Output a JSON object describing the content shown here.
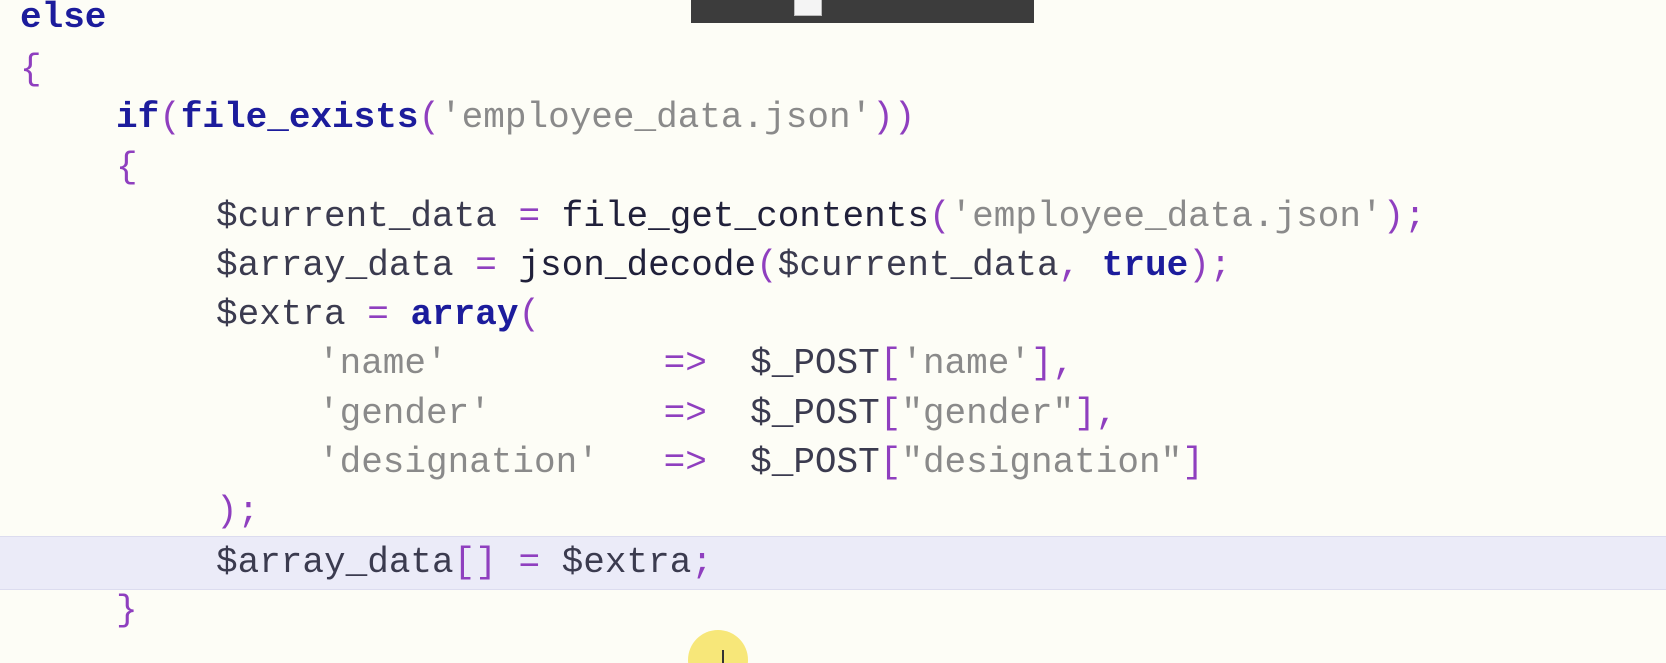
{
  "editor": {
    "lines": [
      {
        "segments": [
          {
            "t": "else",
            "c": "kw"
          }
        ]
      },
      {
        "segments": [
          {
            "t": "{",
            "c": "punct"
          }
        ]
      },
      {
        "segments": [
          {
            "t": "if",
            "c": "kw"
          },
          {
            "t": "(",
            "c": "punct"
          },
          {
            "t": "file_exists",
            "c": "kw"
          },
          {
            "t": "(",
            "c": "punct"
          },
          {
            "t": "'employee_data.json'",
            "c": "str"
          },
          {
            "t": "))",
            "c": "punct"
          }
        ]
      },
      {
        "segments": [
          {
            "t": "{",
            "c": "punct"
          }
        ]
      },
      {
        "segments": [
          {
            "t": "$current_data",
            "c": "var"
          },
          {
            "t": " = ",
            "c": "op"
          },
          {
            "t": "file_get_contents",
            "c": "fn"
          },
          {
            "t": "(",
            "c": "punct"
          },
          {
            "t": "'employee_data.json'",
            "c": "str"
          },
          {
            "t": ");",
            "c": "punct"
          }
        ]
      },
      {
        "segments": [
          {
            "t": "$array_data",
            "c": "var"
          },
          {
            "t": " = ",
            "c": "op"
          },
          {
            "t": "json_decode",
            "c": "fn"
          },
          {
            "t": "(",
            "c": "punct"
          },
          {
            "t": "$current_data",
            "c": "var"
          },
          {
            "t": ", ",
            "c": "punct"
          },
          {
            "t": "true",
            "c": "kw"
          },
          {
            "t": ");",
            "c": "punct"
          }
        ]
      },
      {
        "segments": [
          {
            "t": "$extra",
            "c": "var"
          },
          {
            "t": " = ",
            "c": "op"
          },
          {
            "t": "array",
            "c": "kw"
          },
          {
            "t": "(",
            "c": "punct"
          }
        ]
      },
      {
        "segments": [
          {
            "t": "'name'",
            "c": "str"
          },
          {
            "t": "          ",
            "c": "var"
          },
          {
            "t": "=>",
            "c": "op"
          },
          {
            "t": "  ",
            "c": "var"
          },
          {
            "t": "$_POST",
            "c": "var"
          },
          {
            "t": "[",
            "c": "punct"
          },
          {
            "t": "'name'",
            "c": "str"
          },
          {
            "t": "],",
            "c": "punct"
          }
        ]
      },
      {
        "segments": [
          {
            "t": "'gender'",
            "c": "str"
          },
          {
            "t": "        ",
            "c": "var"
          },
          {
            "t": "=>",
            "c": "op"
          },
          {
            "t": "  ",
            "c": "var"
          },
          {
            "t": "$_POST",
            "c": "var"
          },
          {
            "t": "[",
            "c": "punct"
          },
          {
            "t": "\"gender\"",
            "c": "str"
          },
          {
            "t": "],",
            "c": "punct"
          }
        ]
      },
      {
        "segments": [
          {
            "t": "'designation'",
            "c": "str"
          },
          {
            "t": "   ",
            "c": "var"
          },
          {
            "t": "=>",
            "c": "op"
          },
          {
            "t": "  ",
            "c": "var"
          },
          {
            "t": "$_POST",
            "c": "var"
          },
          {
            "t": "[",
            "c": "punct"
          },
          {
            "t": "\"designation\"",
            "c": "str"
          },
          {
            "t": "]",
            "c": "punct"
          }
        ]
      },
      {
        "segments": [
          {
            "t": ");",
            "c": "punct"
          }
        ]
      },
      {
        "segments": [
          {
            "t": "$array_data",
            "c": "var"
          },
          {
            "t": "[]",
            "c": "punct"
          },
          {
            "t": " = ",
            "c": "op"
          },
          {
            "t": "$extra",
            "c": "var"
          },
          {
            "t": ";",
            "c": "punct"
          }
        ]
      },
      {
        "segments": [
          {
            "t": "}",
            "c": "punct"
          }
        ]
      }
    ],
    "current_line": 12
  },
  "colors": {
    "background": "#fdfdf6",
    "current_line": "#ebebf8",
    "keyword": "#1c1c9c",
    "string": "#8a8a8a",
    "punctuation": "#8f3fbf",
    "cursor_highlight": "#f5e15a"
  }
}
